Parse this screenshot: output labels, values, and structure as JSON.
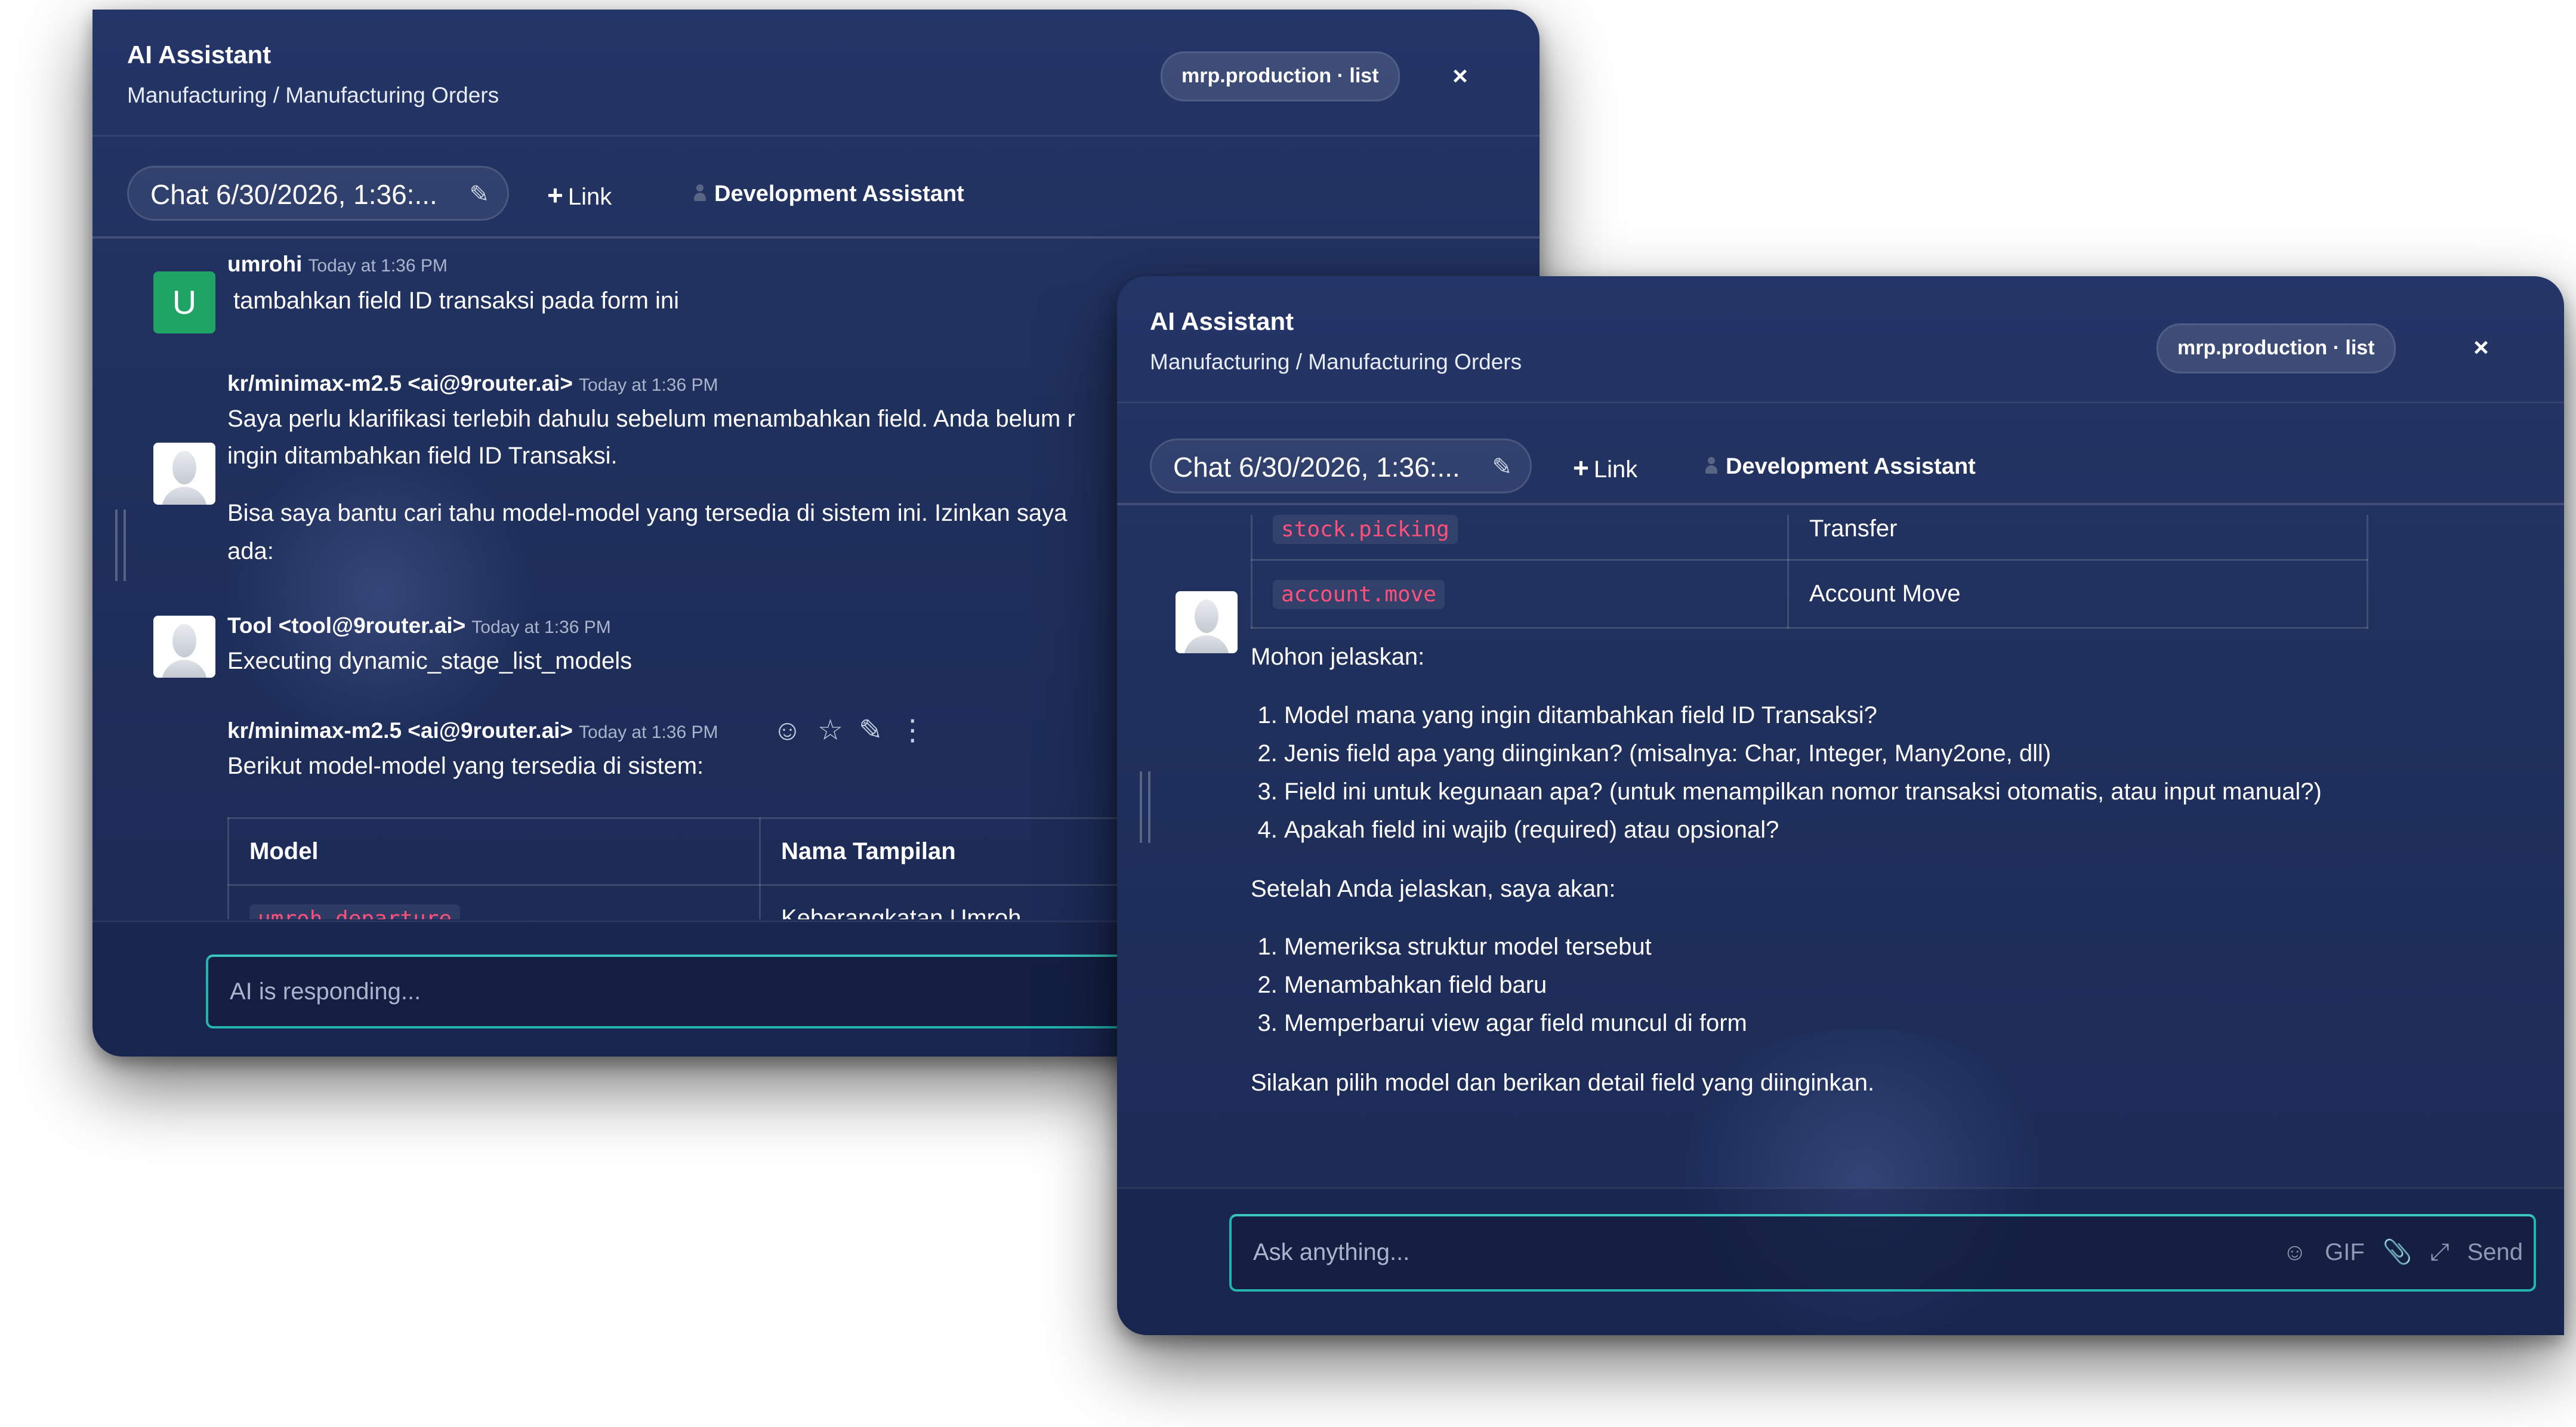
{
  "window_back": {
    "title": "AI Assistant",
    "breadcrumb": "Manufacturing / Manufacturing Orders",
    "model_badge": "mrp.production · list",
    "close_icon": "×",
    "chat_name": "Chat 6/30/2026, 1:36:...",
    "link_label": "Link",
    "dev_label": "Development Assistant",
    "messages": [
      {
        "avatar": "U",
        "author": "umrohi",
        "time": "Today at 1:36 PM",
        "lines": [
          "tambahkan field ID transaksi pada form ini"
        ]
      },
      {
        "author": "kr/minimax-m2.5 <ai@9router.ai>",
        "time": "Today at 1:36 PM",
        "lines": [
          "Saya perlu klarifikasi terlebih dahulu sebelum menambahkan field. Anda belum r",
          "ingin ditambahkan field ID Transaksi.",
          "Bisa saya bantu cari tahu model-model yang tersedia di sistem ini. Izinkan saya",
          "ada:"
        ]
      },
      {
        "author": "Tool <tool@9router.ai>",
        "time": "Today at 1:36 PM",
        "lines": [
          "Executing dynamic_stage_list_models"
        ]
      },
      {
        "author": "kr/minimax-m2.5 <ai@9router.ai>",
        "time": "Today at 1:36 PM",
        "lines": [
          "Berikut model-model yang tersedia di sistem:"
        ]
      }
    ],
    "table_headers": [
      "Model",
      "Nama Tampilan"
    ],
    "table_rows": [
      [
        "umroh.departure",
        "Keberangkatan Umroh"
      ]
    ],
    "input_placeholder": "AI is responding..."
  },
  "window_front": {
    "title": "AI Assistant",
    "breadcrumb": "Manufacturing / Manufacturing Orders",
    "model_badge": "mrp.production · list",
    "close_icon": "×",
    "chat_name": "Chat 6/30/2026, 1:36:...",
    "link_label": "Link",
    "dev_label": "Development Assistant",
    "table_rows": [
      [
        "stock.picking",
        "Transfer"
      ],
      [
        "account.move",
        "Account Move"
      ]
    ],
    "ask_heading": "Mohon jelaskan:",
    "questions": [
      "Model mana yang ingin ditambahkan field ID Transaksi?",
      "Jenis field apa yang diinginkan? (misalnya: Char, Integer, Many2one, dll)",
      "Field ini untuk kegunaan apa? (untuk menampilkan nomor transaksi otomatis, atau input manual?)",
      "Apakah field ini wajib (required) atau opsional?"
    ],
    "after_heading": "Setelah Anda jelaskan, saya akan:",
    "steps": [
      "Memeriksa struktur model tersebut",
      "Menambahkan field baru",
      "Memperbarui view agar field muncul di form"
    ],
    "closing": "Silakan pilih model dan berikan detail field yang diinginkan.",
    "input_placeholder": "Ask anything...",
    "gif_label": "GIF",
    "send_label": "Send"
  }
}
